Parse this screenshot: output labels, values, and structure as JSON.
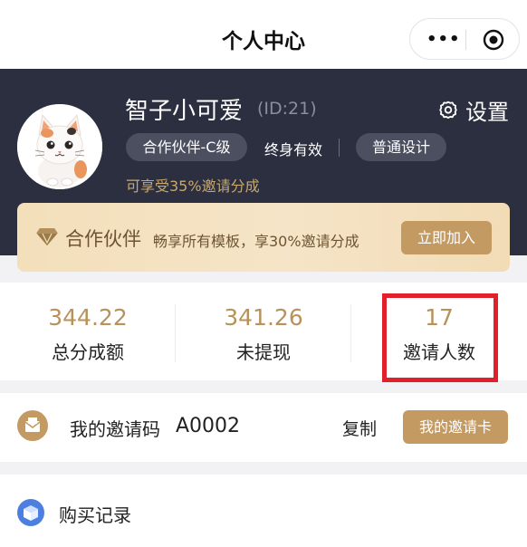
{
  "navbar": {
    "title": "个人中心",
    "more_icon": "more-dots-icon",
    "close_icon": "target-circle-icon"
  },
  "profile": {
    "username": "智子小可爱",
    "user_id": "(ID:21)",
    "settings_label": "设置",
    "settings_icon": "gear-icon",
    "partner_tag": "合作伙伴-C级",
    "validity": "终身有效",
    "design_tag": "普通设计",
    "share_note": "可享受35%邀请分成"
  },
  "banner": {
    "title": "合作伙伴",
    "description": "畅享所有模板，享30%邀请分成",
    "join_label": "立即加入",
    "icon": "diamond-icon"
  },
  "stats": [
    {
      "value": "344.22",
      "label": "总分成额"
    },
    {
      "value": "341.26",
      "label": "未提现"
    },
    {
      "value": "17",
      "label": "邀请人数"
    }
  ],
  "invite": {
    "label": "我的邀请码",
    "code": "A0002",
    "copy_label": "复制",
    "card_label": "我的邀请卡",
    "icon": "envelope-icon"
  },
  "records": {
    "label": "购买记录",
    "icon": "cube-icon"
  },
  "colors": {
    "header_bg": "#2b2f3f",
    "gold": "#c39a62",
    "stat_number": "#b8925a",
    "highlight_red": "#e0212b"
  }
}
